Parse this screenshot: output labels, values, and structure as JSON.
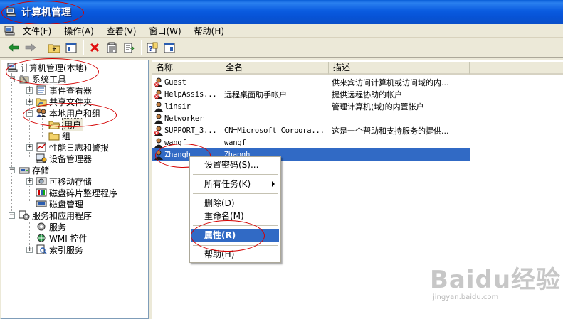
{
  "window": {
    "title": "计算机管理"
  },
  "menu": [
    "文件(F)",
    "操作(A)",
    "查看(V)",
    "窗口(W)",
    "帮助(H)"
  ],
  "toolbar": [
    "back-icon",
    "forward-icon",
    "up-folder-icon",
    "show-hide-tree-icon",
    "delete-icon",
    "properties-icon",
    "export-icon",
    "help-icon",
    "console-tree-icon"
  ],
  "tree": {
    "root": "计算机管理(本地)",
    "system_tools": "系统工具",
    "event_viewer": "事件查看器",
    "shared_folders": "共享文件夹",
    "local_users_groups": "本地用户和组",
    "users": "用户",
    "groups": "组",
    "perf_logs": "性能日志和警报",
    "device_manager": "设备管理器",
    "storage": "存储",
    "removable_storage": "可移动存储",
    "defrag": "磁盘碎片整理程序",
    "disk_mgmt": "磁盘管理",
    "services_apps": "服务和应用程序",
    "services": "服务",
    "wmi": "WMI 控件",
    "indexing": "索引服务"
  },
  "list": {
    "columns": [
      "名称",
      "全名",
      "描述"
    ],
    "rows": [
      {
        "name": "Guest",
        "fullname": "",
        "desc": "供来宾访问计算机或访问域的内...",
        "disabled": true
      },
      {
        "name": "HelpAssis...",
        "fullname": "远程桌面助手帐户",
        "desc": "提供远程协助的帐户",
        "disabled": true
      },
      {
        "name": "linsir",
        "fullname": "",
        "desc": "管理计算机(域)的内置帐户",
        "disabled": false
      },
      {
        "name": "Networker",
        "fullname": "",
        "desc": "",
        "disabled": false
      },
      {
        "name": "SUPPORT_3...",
        "fullname": "CN=Microsoft Corpora...",
        "desc": "这是一个帮助和支持服务的提供...",
        "disabled": true
      },
      {
        "name": "wangf",
        "fullname": "wangf",
        "desc": "",
        "disabled": false
      },
      {
        "name": "Zhangh",
        "fullname": "Zhangh",
        "desc": "",
        "disabled": false,
        "selected": true
      }
    ]
  },
  "context_menu": {
    "set_password": "设置密码(S)...",
    "all_tasks": "所有任务(K)",
    "delete": "删除(D)",
    "rename": "重命名(M)",
    "properties": "属性(R)",
    "help": "帮助(H)"
  },
  "watermark": {
    "logo": "Baidu经验",
    "url": "jingyan.baidu.com"
  },
  "colors": {
    "titlebar": "#0a5be0",
    "selection": "#316ac5",
    "annotation": "#d40000",
    "chrome": "#ece9d8"
  }
}
